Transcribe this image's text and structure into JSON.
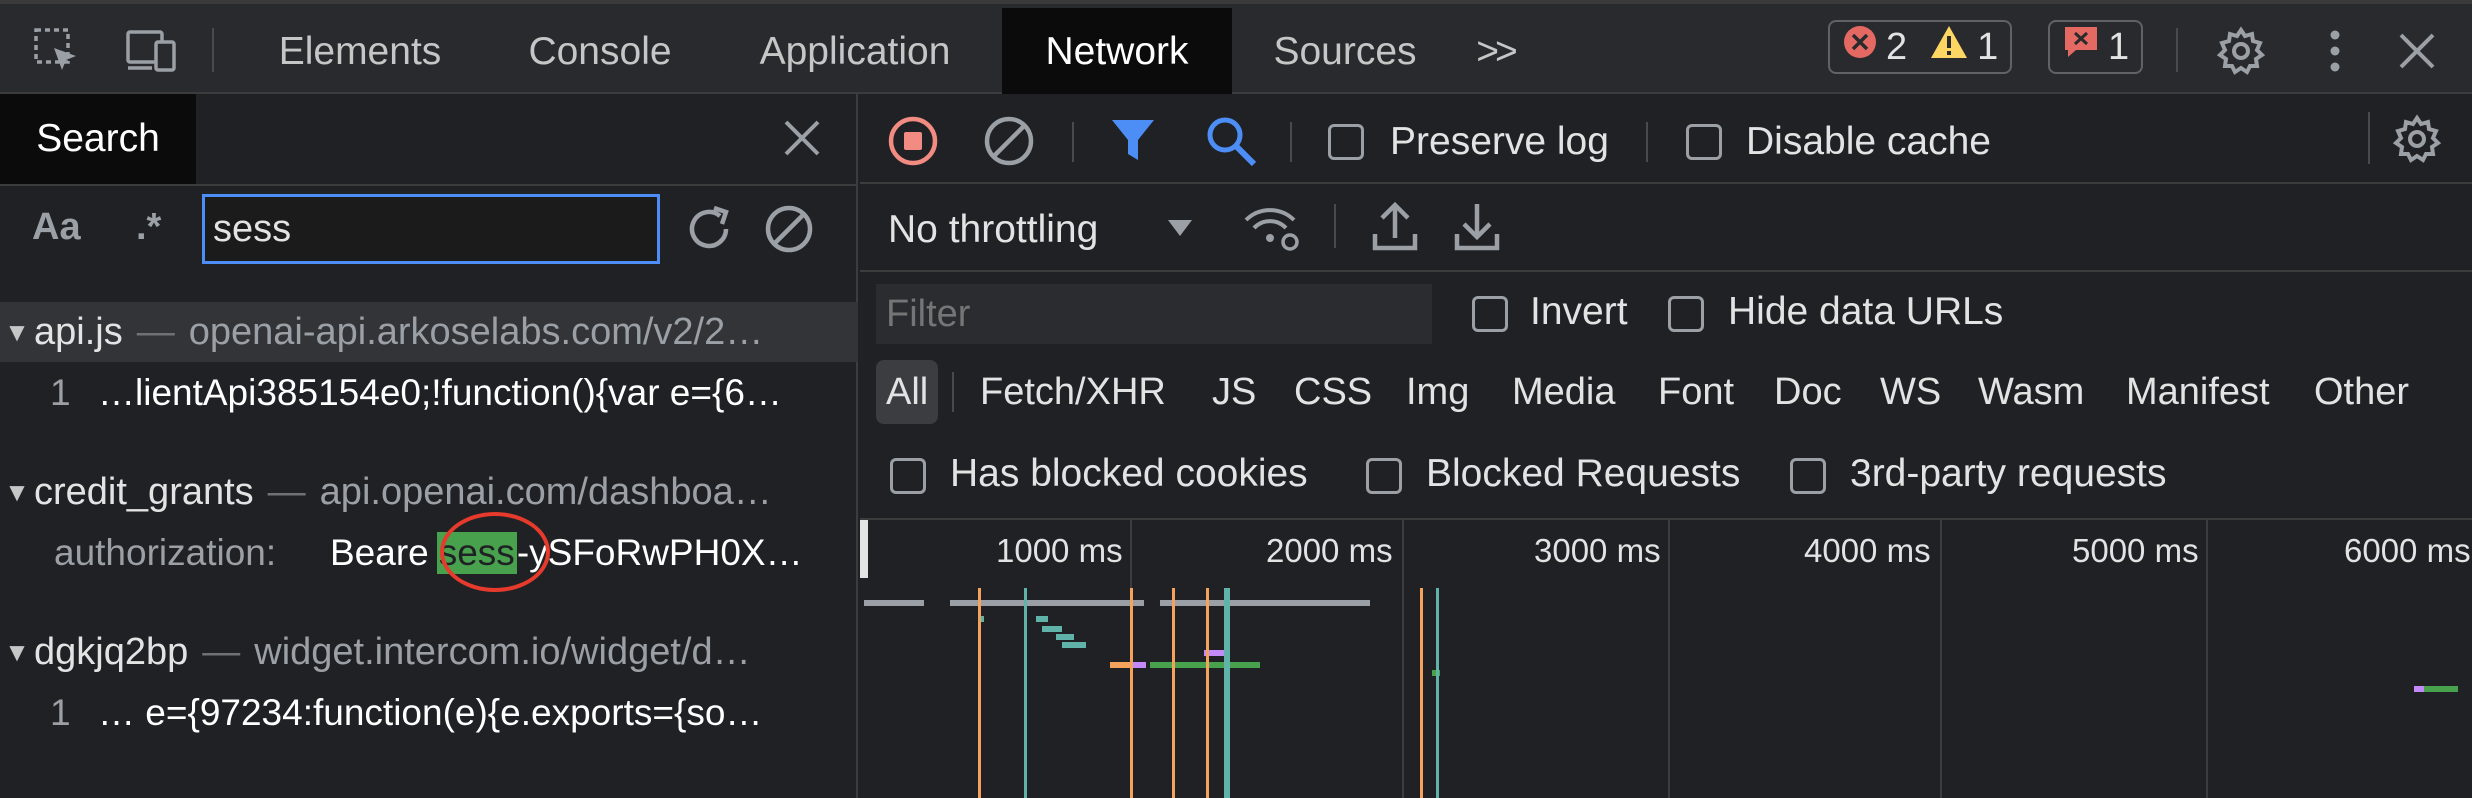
{
  "toolbar": {
    "tabs": [
      "Elements",
      "Console",
      "Application",
      "Network",
      "Sources"
    ],
    "more_tabs_label": ">>",
    "errors_count": "2",
    "warnings_count": "1",
    "issues_count": "1"
  },
  "search_panel": {
    "tab_label": "Search",
    "case_toggle": "Aa",
    "regex_toggle": ".*",
    "query": "sess",
    "results": [
      {
        "file": "api.js",
        "url": "openai-api.arkoselabs.com/v2/2…",
        "line_number": "1",
        "snippet": "…lientApi385154e0;!function(){var e={6…"
      },
      {
        "file": "credit_grants",
        "url": "api.openai.com/dashboa…",
        "header_name": "authorization:",
        "value_prefix": "Beare",
        "value_match": "sess",
        "value_suffix": "-ySFoRwPH0X…"
      },
      {
        "file": "dgkjq2bp",
        "url": "widget.intercom.io/widget/d…",
        "line_number": "1",
        "snippet": "… e={97234:function(e){e.exports={so…"
      }
    ]
  },
  "network": {
    "preserve_log": "Preserve log",
    "disable_cache": "Disable cache",
    "throttling": "No throttling",
    "filter_placeholder": "Filter",
    "invert": "Invert",
    "hide_data_urls": "Hide data URLs",
    "filter_types": [
      "All",
      "Fetch/XHR",
      "JS",
      "CSS",
      "Img",
      "Media",
      "Font",
      "Doc",
      "WS",
      "Wasm",
      "Manifest",
      "Other"
    ],
    "has_blocked_cookies": "Has blocked cookies",
    "blocked_requests": "Blocked Requests",
    "third_party": "3rd-party requests",
    "timeline_ticks": [
      "1000 ms",
      "2000 ms",
      "3000 ms",
      "4000 ms",
      "5000 ms",
      "6000 ms"
    ]
  },
  "colors": {
    "accent_blue": "#8ab4f8",
    "filter_blue": "#4c8df6",
    "record_red": "#f28b82",
    "error_red": "#e46962",
    "warning_yellow": "#fdd663",
    "match_green": "#48a14d",
    "annotation_red": "#e53a2c"
  }
}
